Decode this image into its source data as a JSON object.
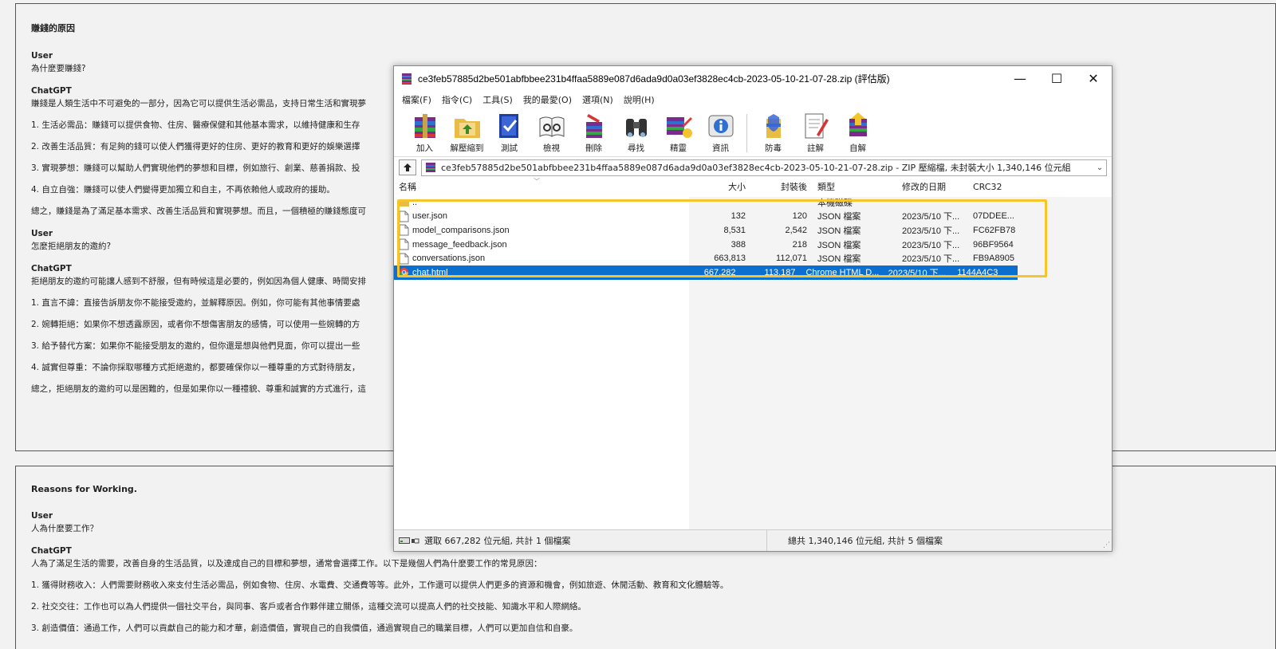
{
  "page1": {
    "title": "賺錢的原因",
    "blocks": [
      {
        "speaker": "User",
        "lines": [
          "為什麼要賺錢?"
        ]
      },
      {
        "speaker": "ChatGPT",
        "lines": [
          "賺錢是人類生活中不可避免的一部分，因為它可以提供生活必需品，支持日常生活和實現夢",
          "1. 生活必需品：賺錢可以提供食物、住房、醫療保健和其他基本需求，以維持健康和生存",
          "2. 改善生活品質：有足夠的錢可以使人們獲得更好的住房、更好的教育和更好的娛樂選擇",
          "3. 實現夢想：賺錢可以幫助人們實現他們的夢想和目標，例如旅行、創業、慈善捐款、投",
          "4. 自立自強：賺錢可以使人們變得更加獨立和自主，不再依賴他人或政府的援助。",
          "總之，賺錢是為了滿足基本需求、改善生活品質和實現夢想。而且，一個積極的賺錢態度可"
        ]
      },
      {
        "speaker": "User",
        "lines": [
          "怎麼拒絕朋友的邀約?"
        ]
      },
      {
        "speaker": "ChatGPT",
        "lines": [
          "拒絕朋友的邀約可能讓人感到不舒服，但有時候這是必要的，例如因為個人健康、時間安排",
          "1. 直言不諱：直接告訴朋友你不能接受邀約，並解釋原因。例如，你可能有其他事情要處",
          "2. 婉轉拒絕：如果你不想透露原因，或者你不想傷害朋友的感情，可以使用一些婉轉的方",
          "3. 給予替代方案：如果你不能接受朋友的邀約，但你還是想與他們見面，你可以提出一些",
          "4. 誠實但尊重：不論你採取哪種方式拒絕邀約，都要確保你以一種尊重的方式對待朋友，",
          "總之，拒絕朋友的邀約可以是困難的，但是如果你以一種禮貌、尊重和誠實的方式進行，這"
        ]
      }
    ]
  },
  "page2": {
    "title": "Reasons for Working.",
    "blocks": [
      {
        "speaker": "User",
        "lines": [
          "人為什麼要工作？"
        ]
      },
      {
        "speaker": "ChatGPT",
        "lines": [
          "人為了滿足生活的需要，改善自身的生活品質，以及達成自己的目標和夢想，通常會選擇工作。以下是幾個人們為什麼要工作的常見原因：",
          "1. 獲得財務收入：人們需要財務收入來支付生活必需品，例如食物、住房、水電費、交通費等等。此外，工作還可以提供人們更多的資源和機會，例如旅遊、休閒活動、教育和文化體驗等。",
          "2. 社交交往：工作也可以為人們提供一個社交平台，與同事、客戶或者合作夥伴建立關係，這種交流可以提高人們的社交技能、知識水平和人際網絡。",
          "3. 創造價值：通過工作，人們可以貢獻自己的能力和才華，創造價值，實現自己的自我價值，通過實現自己的職業目標，人們可以更加自信和自豪。"
        ]
      }
    ]
  },
  "winrar": {
    "title": "ce3feb57885d2be501abfbbee231b4ffaa5889e087d6ada9d0a03ef3828ec4cb-2023-05-10-21-07-28.zip (評估版)",
    "controls": {
      "minimize": "—",
      "maximize": "☐",
      "close": "✕"
    },
    "menu": [
      "檔案(F)",
      "指令(C)",
      "工具(S)",
      "我的最愛(O)",
      "選項(N)",
      "說明(H)"
    ],
    "toolbar": [
      "加入",
      "解壓縮到",
      "測試",
      "檢視",
      "刪除",
      "尋找",
      "精靈",
      "資訊",
      "防毒",
      "註解",
      "自解"
    ],
    "address": "ce3feb57885d2be501abfbbee231b4ffaa5889e087d6ada9d0a03ef3828ec4cb-2023-05-10-21-07-28.zip - ZIP 壓縮檔, 未封裝大小 1,340,146 位元組",
    "columns": {
      "name": "名稱",
      "size": "大小",
      "packed": "封裝後",
      "type": "類型",
      "modified": "修改的日期",
      "crc": "CRC32"
    },
    "parent_row": {
      "name": "..",
      "type": "本機磁碟"
    },
    "files": [
      {
        "name": "user.json",
        "size": "132",
        "packed": "120",
        "type": "JSON 檔案",
        "modified": "2023/5/10 下...",
        "crc": "07DDEE..."
      },
      {
        "name": "model_comparisons.json",
        "size": "8,531",
        "packed": "2,542",
        "type": "JSON 檔案",
        "modified": "2023/5/10 下...",
        "crc": "FC62FB78"
      },
      {
        "name": "message_feedback.json",
        "size": "388",
        "packed": "218",
        "type": "JSON 檔案",
        "modified": "2023/5/10 下...",
        "crc": "96BF9564"
      },
      {
        "name": "conversations.json",
        "size": "663,813",
        "packed": "112,071",
        "type": "JSON 檔案",
        "modified": "2023/5/10 下...",
        "crc": "FB9A8905"
      },
      {
        "name": "chat.html",
        "size": "667,282",
        "packed": "113,187",
        "type": "Chrome HTML D...",
        "modified": "2023/5/10 下...",
        "crc": "1144A4C3"
      }
    ],
    "status_left": "選取 667,282 位元組, 共計 1 個檔案",
    "status_right": "總共 1,340,146 位元組, 共計 5 個檔案",
    "highlight_color": "#f7c52b",
    "selection_color": "#0b6fd0"
  }
}
